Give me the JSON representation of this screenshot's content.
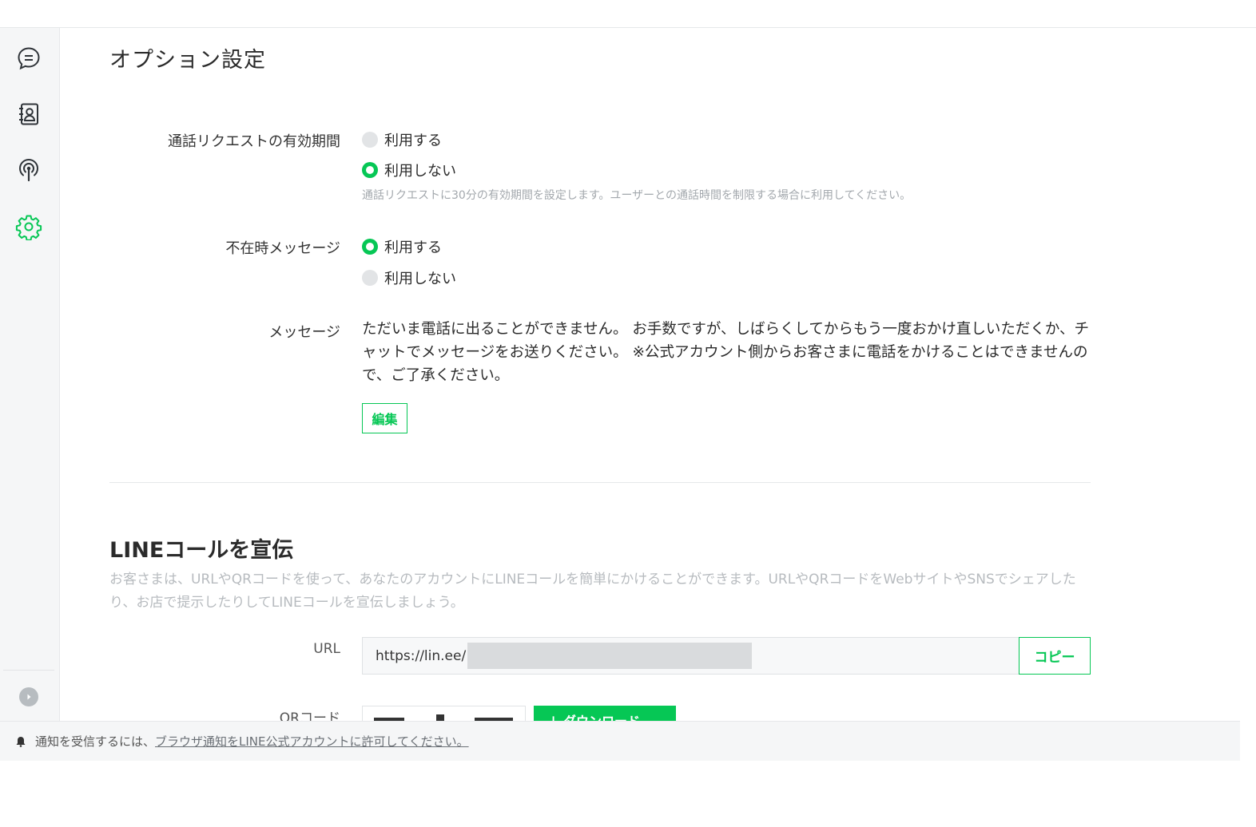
{
  "sidebar": {
    "items": [
      {
        "icon": "chat-icon"
      },
      {
        "icon": "contacts-icon"
      },
      {
        "icon": "broadcast-icon"
      },
      {
        "icon": "gear-icon",
        "active": true
      }
    ],
    "accent": "#06c755"
  },
  "options": {
    "title": "オプション設定",
    "call_request": {
      "label": "通話リクエストの有効期間",
      "opt_use": "利用する",
      "opt_not": "利用しない",
      "selected": "利用しない",
      "hint": "通話リクエストに30分の有効期間を設定します。ユーザーとの通話時間を制限する場合に利用してください。"
    },
    "absent": {
      "label": "不在時メッセージ",
      "opt_use": "利用する",
      "opt_not": "利用しない",
      "selected": "利用する"
    },
    "message": {
      "label": "メッセージ",
      "text": "ただいま電話に出ることができません。 お手数ですが、しばらくしてからもう一度おかけ直しいただくか、チャットでメッセージをお送りください。 ※公式アカウント側からお客さまに電話をかけることはできませんので、ご了承ください。",
      "edit_label": "編集"
    }
  },
  "promo": {
    "title": "LINEコールを宣伝",
    "desc": "お客さまは、URLやQRコードを使って、あなたのアカウントにLINEコールを簡単にかけることができます。URLやQRコードをWebサイトやSNSでシェアしたり、お店で提示したりしてLINEコールを宣伝しましょう。",
    "url_label": "URL",
    "url_value": "https://lin.ee/",
    "copy_label": "コピー",
    "qr_label": "QRコード",
    "download_label": "↓ ダウンロード"
  },
  "notice": {
    "text": "通知を受信するには、",
    "link": "ブラウザ通知をLINE公式アカウントに許可してください。"
  }
}
